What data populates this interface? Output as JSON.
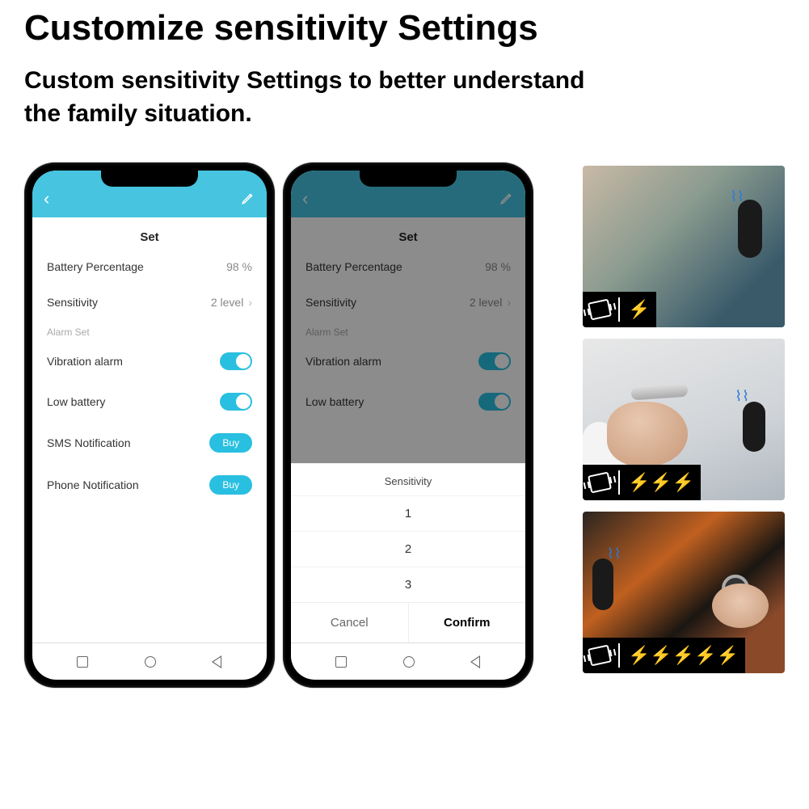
{
  "title": "Customize sensitivity Settings",
  "subtitle_line1": "Custom sensitivity Settings to better understand",
  "subtitle_line2": "the family situation.",
  "app": {
    "screen_title": "Set",
    "battery_label": "Battery Percentage",
    "battery_value": "98 %",
    "sensitivity_label": "Sensitivity",
    "sensitivity_value": "2 level",
    "section_label": "Alarm Set",
    "vibration_label": "Vibration alarm",
    "lowbattery_label": "Low battery",
    "sms_label": "SMS Notification",
    "phone_label": "Phone Notification",
    "buy_label": "Buy"
  },
  "modal": {
    "title": "Sensitivity",
    "option1": "1",
    "option2": "2",
    "option3": "3",
    "cancel": "Cancel",
    "confirm": "Confirm"
  },
  "thumbs": {
    "bolt": "⚡"
  }
}
